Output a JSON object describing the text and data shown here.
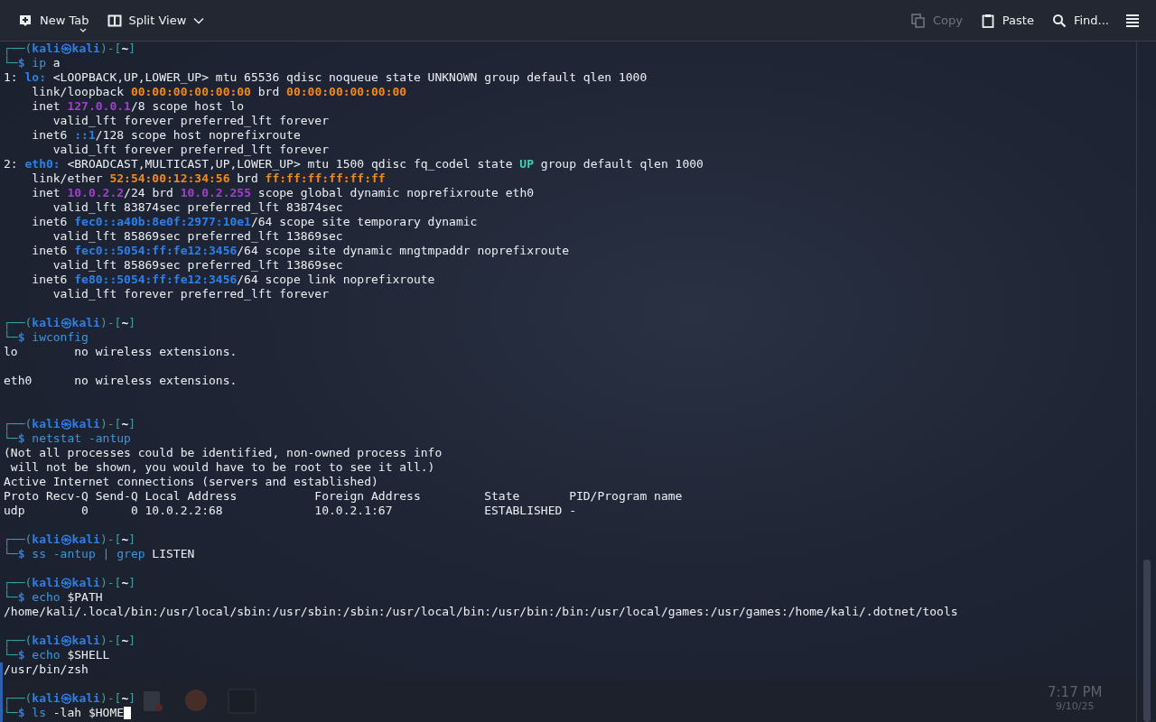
{
  "toolbar": {
    "left": [
      {
        "kind": "new-tab",
        "label": "New Tab",
        "disabled": false
      },
      {
        "kind": "split",
        "label": "Split View",
        "disabled": false
      }
    ],
    "right": [
      {
        "kind": "copy",
        "label": "Copy",
        "disabled": true
      },
      {
        "kind": "paste",
        "label": "Paste",
        "disabled": false
      },
      {
        "kind": "find",
        "label": "Find...",
        "disabled": false
      }
    ]
  },
  "terminal": {
    "cursor": true,
    "lines": [
      {
        "kind": "text",
        "spans": [
          {
            "text": "┌──(",
            "kind": "frame"
          },
          {
            "text": "kali㉿kali",
            "kind": "user"
          },
          {
            "text": ")-[",
            "kind": "frame"
          },
          {
            "text": "~",
            "kind": "directory"
          },
          {
            "text": "]",
            "kind": "frame"
          }
        ]
      },
      {
        "kind": "text",
        "spans": [
          {
            "text": "└─",
            "kind": "frame"
          },
          {
            "text": "$ ",
            "kind": "dollar"
          },
          {
            "text": "ip",
            "kind": "command"
          },
          {
            "text": " a",
            "kind": "plain"
          }
        ]
      },
      {
        "kind": "text",
        "spans": [
          {
            "text": "1: ",
            "kind": "plain"
          },
          {
            "text": "lo:",
            "kind": "interface"
          },
          {
            "text": " <LOOPBACK,UP,LOWER_UP> mtu 65536 qdisc noqueue state UNKNOWN group default qlen 1000",
            "kind": "plain"
          }
        ]
      },
      {
        "kind": "text",
        "spans": [
          {
            "text": "    link/loopback ",
            "kind": "plain"
          },
          {
            "text": "00:00:00:00:00:00",
            "kind": "mac"
          },
          {
            "text": " brd ",
            "kind": "plain"
          },
          {
            "text": "00:00:00:00:00:00",
            "kind": "mac"
          }
        ]
      },
      {
        "kind": "text",
        "spans": [
          {
            "text": "    inet ",
            "kind": "plain"
          },
          {
            "text": "127.0.0.1",
            "kind": "ipv4"
          },
          {
            "text": "/8 scope host lo",
            "kind": "plain"
          }
        ]
      },
      {
        "kind": "text",
        "spans": [
          {
            "text": "       valid_lft forever preferred_lft forever",
            "kind": "plain"
          }
        ]
      },
      {
        "kind": "text",
        "spans": [
          {
            "text": "    inet6 ",
            "kind": "plain"
          },
          {
            "text": "::1",
            "kind": "ipv6"
          },
          {
            "text": "/128 scope host noprefixroute",
            "kind": "plain"
          }
        ]
      },
      {
        "kind": "text",
        "spans": [
          {
            "text": "       valid_lft forever preferred_lft forever",
            "kind": "plain"
          }
        ]
      },
      {
        "kind": "text",
        "spans": [
          {
            "text": "2: ",
            "kind": "plain"
          },
          {
            "text": "eth0:",
            "kind": "interface"
          },
          {
            "text": " <BROADCAST,MULTICAST,UP,LOWER_UP> mtu 1500 qdisc fq_codel state ",
            "kind": "plain"
          },
          {
            "text": "UP",
            "kind": "state"
          },
          {
            "text": " group default qlen 1000",
            "kind": "plain"
          }
        ]
      },
      {
        "kind": "text",
        "spans": [
          {
            "text": "    link/ether ",
            "kind": "plain"
          },
          {
            "text": "52:54:00:12:34:56",
            "kind": "mac"
          },
          {
            "text": " brd ",
            "kind": "plain"
          },
          {
            "text": "ff:ff:ff:ff:ff:ff",
            "kind": "mac"
          }
        ]
      },
      {
        "kind": "text",
        "spans": [
          {
            "text": "    inet ",
            "kind": "plain"
          },
          {
            "text": "10.0.2.2",
            "kind": "ipv4"
          },
          {
            "text": "/24 brd ",
            "kind": "plain"
          },
          {
            "text": "10.0.2.255",
            "kind": "ipv4"
          },
          {
            "text": " scope global dynamic noprefixroute eth0",
            "kind": "plain"
          }
        ]
      },
      {
        "kind": "text",
        "spans": [
          {
            "text": "       valid_lft 83874sec preferred_lft 83874sec",
            "kind": "plain"
          }
        ]
      },
      {
        "kind": "text",
        "spans": [
          {
            "text": "    inet6 ",
            "kind": "plain"
          },
          {
            "text": "fec0::a40b:8e0f:2977:10e1",
            "kind": "ipv6"
          },
          {
            "text": "/64 scope site temporary dynamic",
            "kind": "plain"
          }
        ]
      },
      {
        "kind": "text",
        "spans": [
          {
            "text": "       valid_lft 85869sec preferred_lft 13869sec",
            "kind": "plain"
          }
        ]
      },
      {
        "kind": "text",
        "spans": [
          {
            "text": "    inet6 ",
            "kind": "plain"
          },
          {
            "text": "fec0::5054:ff:fe12:3456",
            "kind": "ipv6"
          },
          {
            "text": "/64 scope site dynamic mngtmpaddr noprefixroute",
            "kind": "plain"
          }
        ]
      },
      {
        "kind": "text",
        "spans": [
          {
            "text": "       valid_lft 85869sec preferred_lft 13869sec",
            "kind": "plain"
          }
        ]
      },
      {
        "kind": "text",
        "spans": [
          {
            "text": "    inet6 ",
            "kind": "plain"
          },
          {
            "text": "fe80::5054:ff:fe12:3456",
            "kind": "ipv6"
          },
          {
            "text": "/64 scope link noprefixroute",
            "kind": "plain"
          }
        ]
      },
      {
        "kind": "text",
        "spans": [
          {
            "text": "       valid_lft forever preferred_lft forever",
            "kind": "plain"
          }
        ]
      },
      {
        "kind": "blank"
      },
      {
        "kind": "text",
        "spans": [
          {
            "text": "┌──(",
            "kind": "frame"
          },
          {
            "text": "kali㉿kali",
            "kind": "user"
          },
          {
            "text": ")-[",
            "kind": "frame"
          },
          {
            "text": "~",
            "kind": "directory"
          },
          {
            "text": "]",
            "kind": "frame"
          }
        ]
      },
      {
        "kind": "text",
        "spans": [
          {
            "text": "└─",
            "kind": "frame"
          },
          {
            "text": "$ ",
            "kind": "dollar"
          },
          {
            "text": "iwconfig",
            "kind": "command"
          }
        ]
      },
      {
        "kind": "text",
        "spans": [
          {
            "text": "lo        no wireless extensions.",
            "kind": "plain"
          }
        ]
      },
      {
        "kind": "blank"
      },
      {
        "kind": "text",
        "spans": [
          {
            "text": "eth0      no wireless extensions.",
            "kind": "plain"
          }
        ]
      },
      {
        "kind": "blank"
      },
      {
        "kind": "blank"
      },
      {
        "kind": "text",
        "spans": [
          {
            "text": "┌──(",
            "kind": "frame"
          },
          {
            "text": "kali㉿kali",
            "kind": "user"
          },
          {
            "text": ")-[",
            "kind": "frame"
          },
          {
            "text": "~",
            "kind": "directory"
          },
          {
            "text": "]",
            "kind": "frame"
          }
        ]
      },
      {
        "kind": "text",
        "spans": [
          {
            "text": "└─",
            "kind": "frame"
          },
          {
            "text": "$ ",
            "kind": "dollar"
          },
          {
            "text": "netstat -antup",
            "kind": "command"
          }
        ]
      },
      {
        "kind": "text",
        "spans": [
          {
            "text": "(Not all processes could be identified, non-owned process info",
            "kind": "plain"
          }
        ]
      },
      {
        "kind": "text",
        "spans": [
          {
            "text": " will not be shown, you would have to be root to see it all.)",
            "kind": "plain"
          }
        ]
      },
      {
        "kind": "text",
        "spans": [
          {
            "text": "Active Internet connections (servers and established)",
            "kind": "plain"
          }
        ]
      },
      {
        "kind": "text",
        "spans": [
          {
            "text": "Proto Recv-Q Send-Q Local Address           Foreign Address         State       PID/Program name",
            "kind": "plain"
          }
        ]
      },
      {
        "kind": "text",
        "spans": [
          {
            "text": "udp        0      0 10.0.2.2:68             10.0.2.1:67             ESTABLISHED -",
            "kind": "plain"
          }
        ]
      },
      {
        "kind": "blank"
      },
      {
        "kind": "text",
        "spans": [
          {
            "text": "┌──(",
            "kind": "frame"
          },
          {
            "text": "kali㉿kali",
            "kind": "user"
          },
          {
            "text": ")-[",
            "kind": "frame"
          },
          {
            "text": "~",
            "kind": "directory"
          },
          {
            "text": "]",
            "kind": "frame"
          }
        ]
      },
      {
        "kind": "text",
        "spans": [
          {
            "text": "└─",
            "kind": "frame"
          },
          {
            "text": "$ ",
            "kind": "dollar"
          },
          {
            "text": "ss -antup | grep",
            "kind": "command"
          },
          {
            "text": " LISTEN",
            "kind": "plain"
          }
        ]
      },
      {
        "kind": "blank"
      },
      {
        "kind": "text",
        "spans": [
          {
            "text": "┌──(",
            "kind": "frame"
          },
          {
            "text": "kali㉿kali",
            "kind": "user"
          },
          {
            "text": ")-[",
            "kind": "frame"
          },
          {
            "text": "~",
            "kind": "directory"
          },
          {
            "text": "]",
            "kind": "frame"
          }
        ]
      },
      {
        "kind": "text",
        "spans": [
          {
            "text": "└─",
            "kind": "frame"
          },
          {
            "text": "$ ",
            "kind": "dollar"
          },
          {
            "text": "echo",
            "kind": "command"
          },
          {
            "text": " $PATH",
            "kind": "plain"
          }
        ]
      },
      {
        "kind": "text",
        "spans": [
          {
            "text": "/home/kali/.local/bin:/usr/local/sbin:/usr/sbin:/sbin:/usr/local/bin:/usr/bin:/bin:/usr/local/games:/usr/games:/home/kali/.dotnet/tools",
            "kind": "plain"
          }
        ]
      },
      {
        "kind": "blank"
      },
      {
        "kind": "text",
        "spans": [
          {
            "text": "┌──(",
            "kind": "frame"
          },
          {
            "text": "kali㉿kali",
            "kind": "user"
          },
          {
            "text": ")-[",
            "kind": "frame"
          },
          {
            "text": "~",
            "kind": "directory"
          },
          {
            "text": "]",
            "kind": "frame"
          }
        ]
      },
      {
        "kind": "text",
        "spans": [
          {
            "text": "└─",
            "kind": "frame"
          },
          {
            "text": "$ ",
            "kind": "dollar"
          },
          {
            "text": "echo",
            "kind": "command"
          },
          {
            "text": " $SHELL",
            "kind": "plain"
          }
        ]
      },
      {
        "kind": "text",
        "spans": [
          {
            "text": "/usr/bin/zsh",
            "kind": "plain"
          }
        ]
      },
      {
        "kind": "blank"
      },
      {
        "kind": "text",
        "spans": [
          {
            "text": "┌──(",
            "kind": "frame"
          },
          {
            "text": "kali㉿kali",
            "kind": "user"
          },
          {
            "text": ")-[",
            "kind": "frame"
          },
          {
            "text": "~",
            "kind": "directory"
          },
          {
            "text": "]",
            "kind": "frame"
          }
        ]
      },
      {
        "kind": "text",
        "spans": [
          {
            "text": "└─",
            "kind": "frame"
          },
          {
            "text": "$ ",
            "kind": "dollar"
          },
          {
            "text": "ls",
            "kind": "command"
          },
          {
            "text": " -lah $HOME",
            "kind": "plain"
          }
        ]
      }
    ]
  },
  "taskbar": {
    "time": "7:17 PM",
    "date": "9/10/25"
  }
}
